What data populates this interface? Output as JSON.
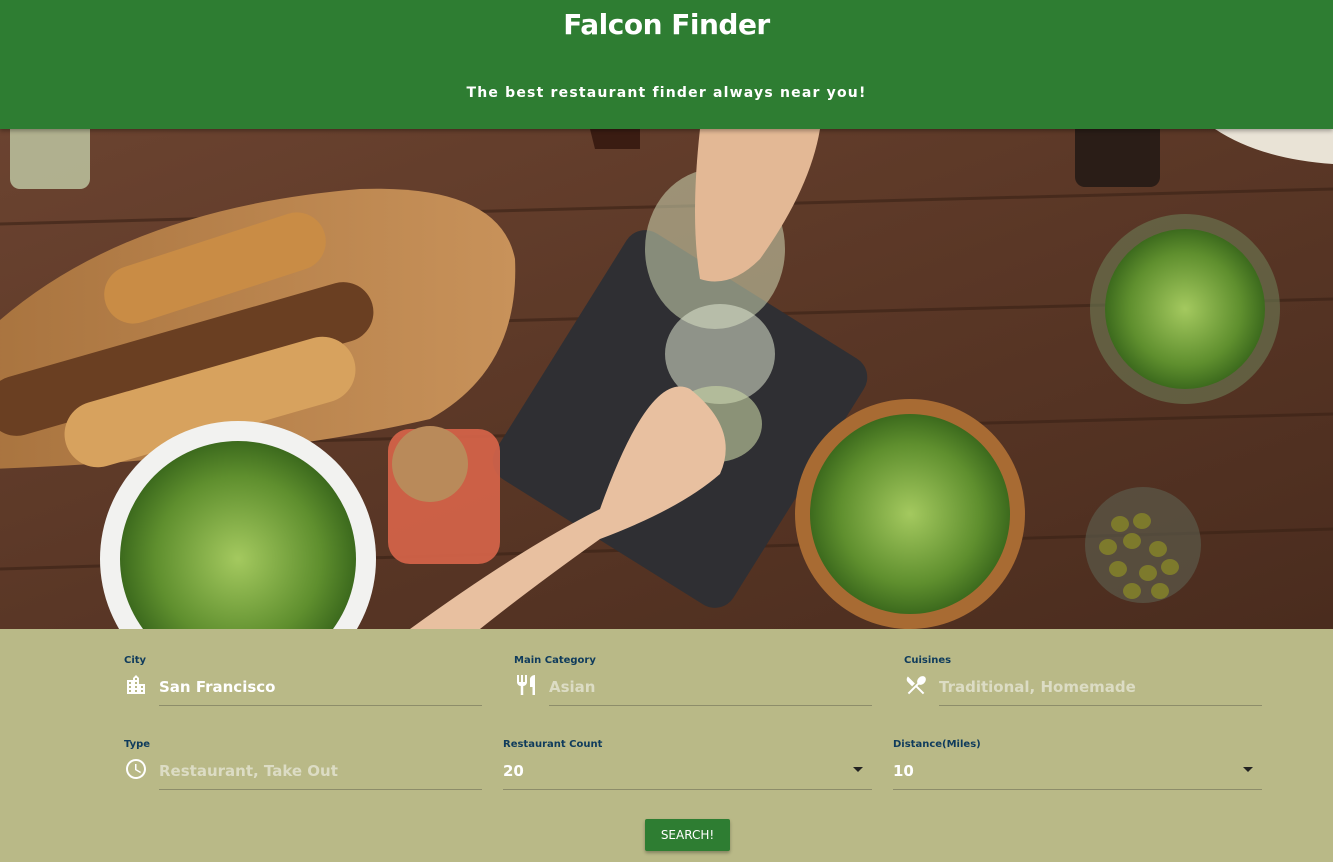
{
  "header": {
    "title": "Falcon Finder",
    "subtitle": "The best restaurant finder always near you!"
  },
  "hero": {
    "description_icon": "food-table-photo"
  },
  "form": {
    "city": {
      "label": "City",
      "value": "San Francisco",
      "icon": "city-icon"
    },
    "main_category": {
      "label": "Main Category",
      "placeholder": "Asian",
      "icon": "fork-knife-icon"
    },
    "cuisines": {
      "label": "Cuisines",
      "placeholder": "Traditional, Homemade",
      "icon": "utensils-cross-icon"
    },
    "type": {
      "label": "Type",
      "placeholder": "Restaurant, Take Out",
      "icon": "clock-icon"
    },
    "restaurant_count": {
      "label": "Restaurant Count",
      "value": "20"
    },
    "distance": {
      "label": "Distance(Miles)",
      "value": "10"
    },
    "search_label": "SEARCH!"
  },
  "colors": {
    "header_bg": "#2e7d32",
    "form_bg": "#b9b987",
    "label": "#0f3b5c",
    "button": "#2e7d32"
  }
}
